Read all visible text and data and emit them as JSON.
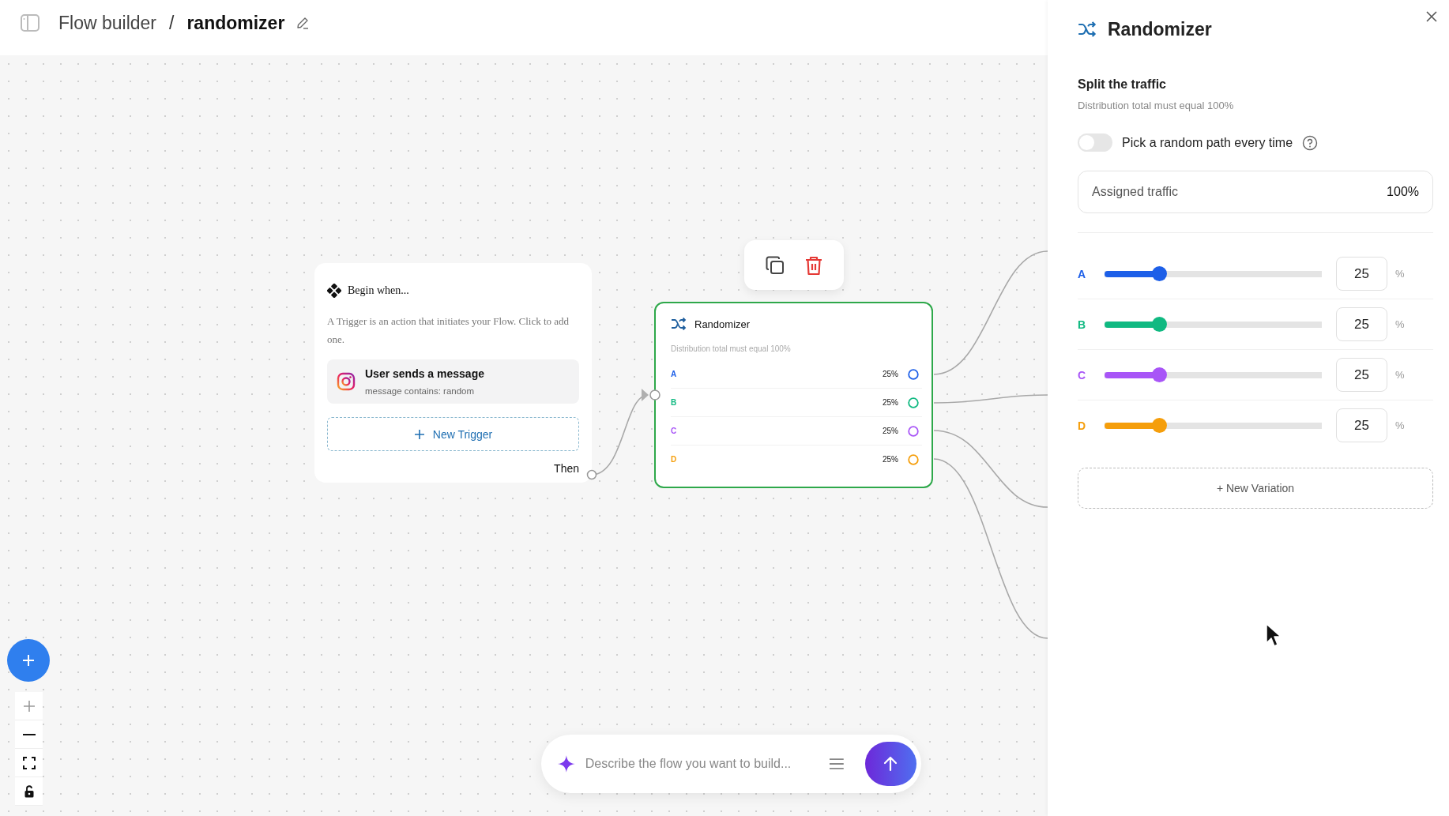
{
  "header": {
    "breadcrumb": "Flow builder",
    "separator": "/",
    "title": "randomizer"
  },
  "canvas": {
    "trigger_card": {
      "title": "Begin when...",
      "description": "A Trigger is an action that initiates your Flow. Click to add one.",
      "trigger": {
        "title": "User sends a message",
        "subtitle": "message contains: random"
      },
      "new_trigger": "New Trigger",
      "then": "Then"
    },
    "randomizer_node": {
      "title": "Randomizer",
      "subtitle": "Distribution total must equal 100%",
      "selected": true,
      "paths": [
        {
          "label": "A",
          "share": "25%",
          "color": "#1d5fe8"
        },
        {
          "label": "B",
          "share": "25%",
          "color": "#10b981"
        },
        {
          "label": "C",
          "share": "25%",
          "color": "#a855f7"
        },
        {
          "label": "D",
          "share": "25%",
          "color": "#f59e0b"
        }
      ]
    },
    "prompt": {
      "placeholder": "Describe the flow you want to build..."
    }
  },
  "panel": {
    "title": "Randomizer",
    "heading": "Split the traffic",
    "subtitle": "Distribution total must equal 100%",
    "random_toggle": {
      "label": "Pick a random path every time",
      "on": false
    },
    "assigned": {
      "label": "Assigned traffic",
      "value": "100%"
    },
    "variations": [
      {
        "label": "A",
        "color": "#1d5fe8",
        "level": 0.25,
        "value": "25",
        "unit": "%"
      },
      {
        "label": "B",
        "color": "#10b981",
        "level": 0.25,
        "value": "25",
        "unit": "%"
      },
      {
        "label": "C",
        "color": "#a855f7",
        "level": 0.25,
        "value": "25",
        "unit": "%"
      },
      {
        "label": "D",
        "color": "#f59e0b",
        "level": 0.25,
        "value": "25",
        "unit": "%"
      }
    ],
    "new_variation": "+ New Variation"
  }
}
